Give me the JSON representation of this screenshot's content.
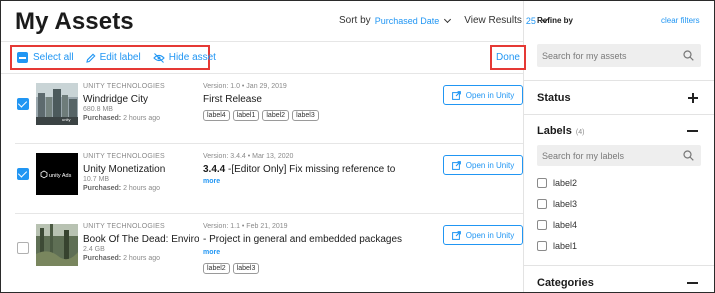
{
  "page_title": "My Assets",
  "sort": {
    "label": "Sort by",
    "value": "Purchased Date"
  },
  "view": {
    "label": "View Results",
    "value": "25"
  },
  "toolbar": {
    "select_all": "Select all",
    "edit_label": "Edit label",
    "hide_asset": "Hide asset",
    "done": "Done"
  },
  "assets": [
    {
      "publisher": "UNITY TECHNOLOGIES",
      "name": "Windridge City",
      "size": "680.8 MB",
      "purchased_label": "Purchased:",
      "purchased_time": "2 hours ago",
      "version": "Version: 1.0 • Jan 29, 2019",
      "release": "First Release",
      "labels": [
        "label4",
        "label1",
        "label2",
        "label3"
      ],
      "checked": true,
      "open_button": "Open in Unity"
    },
    {
      "publisher": "UNITY TECHNOLOGIES",
      "name": "Unity Monetization",
      "size": "10.7 MB",
      "purchased_label": "Purchased:",
      "purchased_time": "2 hours ago",
      "version": "Version: 3.4.4 • Mar 13, 2020",
      "release_bold": "3.4.4",
      "release": " -[Editor Only] Fix missing reference to",
      "more": "more",
      "thumb_text": "unity Ads",
      "checked": true,
      "open_button": "Open in Unity"
    },
    {
      "publisher": "UNITY TECHNOLOGIES",
      "name": "Book Of The Dead: Environment",
      "size": "2.4 GB",
      "purchased_label": "Purchased:",
      "purchased_time": "2 hours ago",
      "version": "Version: 1.1 • Feb 21, 2019",
      "release": "- Project in general and embedded packages",
      "more": "more",
      "labels": [
        "label2",
        "label3"
      ],
      "checked": false,
      "open_button": "Open in Unity"
    }
  ],
  "filters": {
    "title": "Refine by",
    "clear": "clear filters",
    "search_placeholder": "Search for my assets",
    "status_title": "Status",
    "labels_title": "Labels",
    "labels_count": "(4)",
    "labels_search_placeholder": "Search for my labels",
    "label_items": [
      "label2",
      "label3",
      "label4",
      "label1"
    ],
    "categories_title": "Categories"
  },
  "colors": {
    "accent": "#2196f3",
    "highlight": "#e53935"
  }
}
